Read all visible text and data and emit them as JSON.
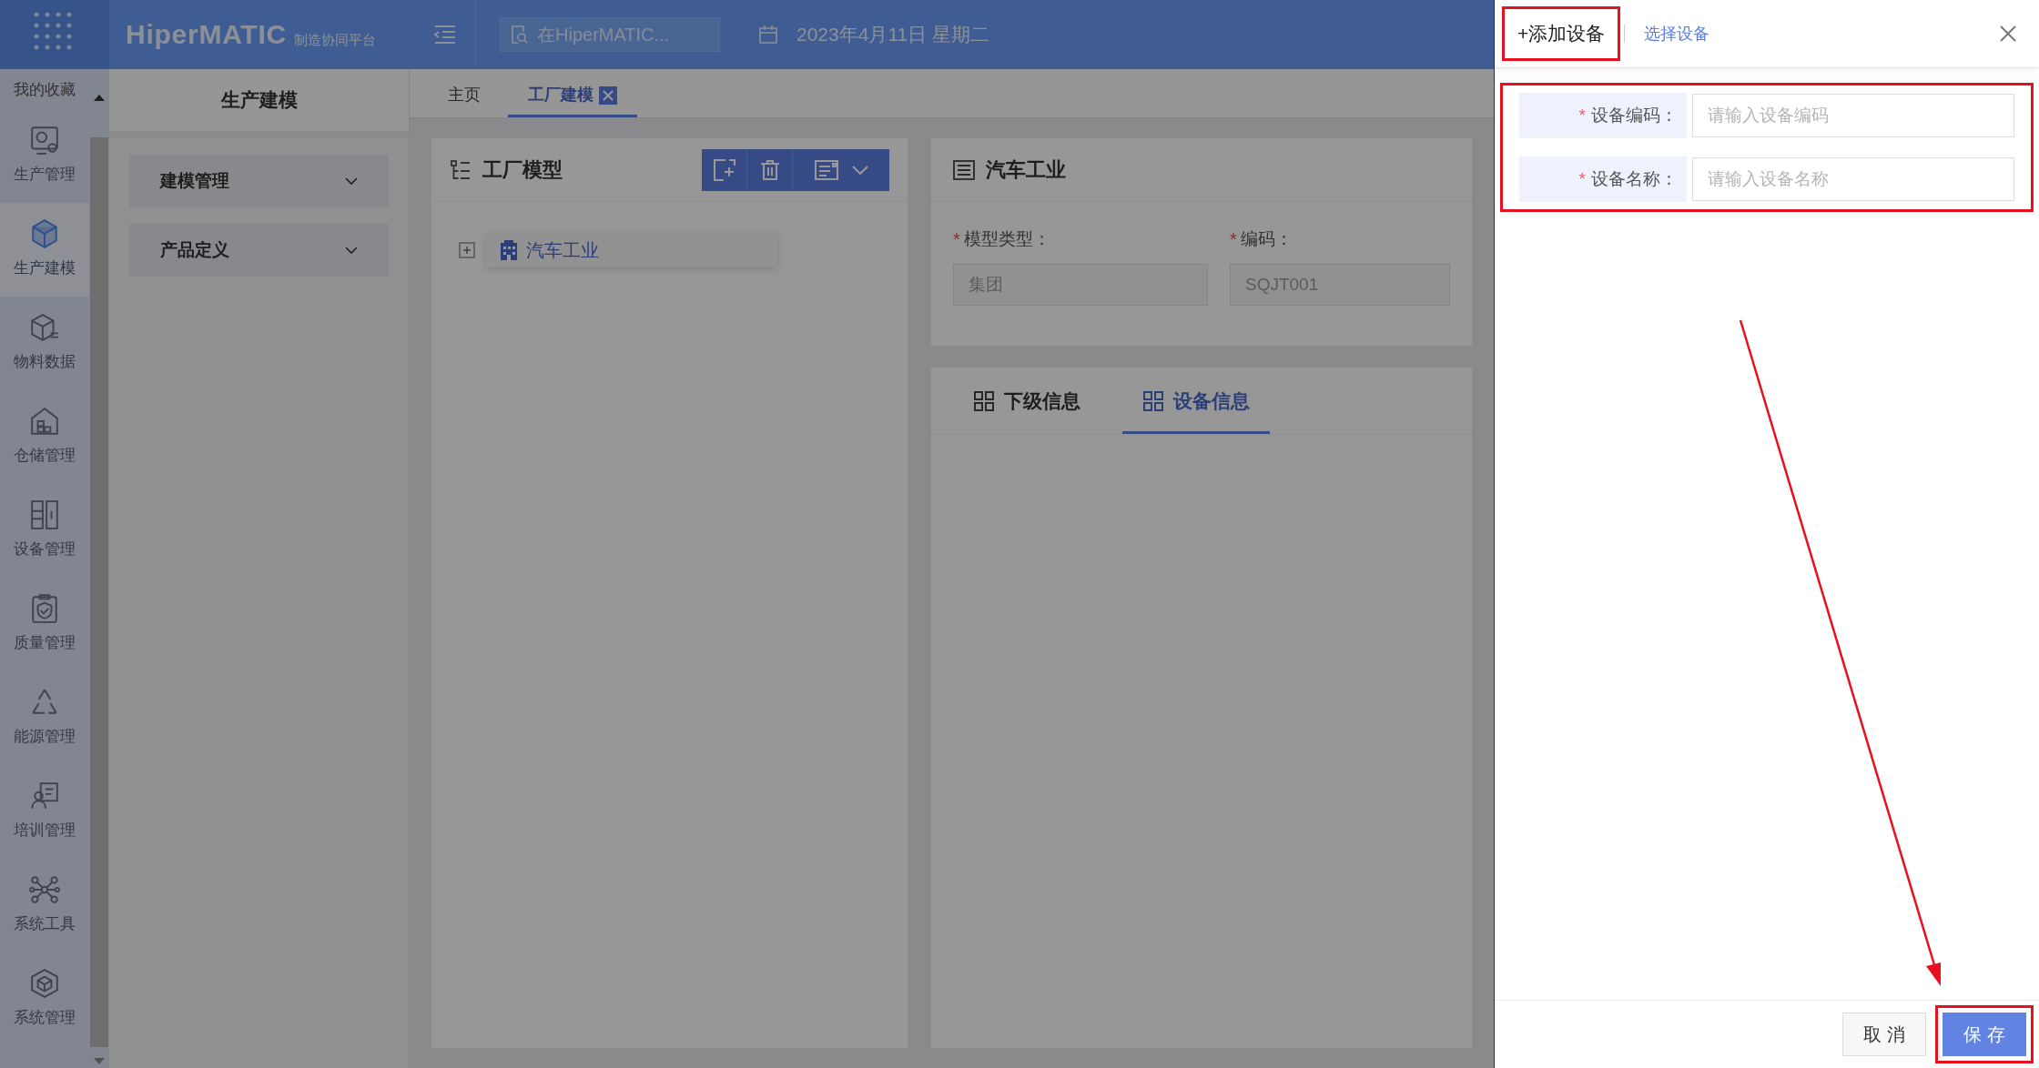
{
  "modal_open": true,
  "top_bar": {
    "logo_text": "HiperMATIC",
    "logo_subtitle": "制造协同平台",
    "search": {
      "placeholder": "在HiperMATIC..."
    },
    "date": "2023年4月11日 星期二"
  },
  "rail": {
    "favorites": "我的收藏",
    "items": [
      {
        "label": "生产管理",
        "selected": false
      },
      {
        "label": "生产建模",
        "selected": true
      },
      {
        "label": "物料数据",
        "selected": false
      },
      {
        "label": "仓储管理",
        "selected": false
      },
      {
        "label": "设备管理",
        "selected": false
      },
      {
        "label": "质量管理",
        "selected": false
      },
      {
        "label": "能源管理",
        "selected": false
      },
      {
        "label": "培训管理",
        "selected": false
      },
      {
        "label": "系统工具",
        "selected": false
      },
      {
        "label": "系统管理",
        "selected": false
      }
    ]
  },
  "submenu": {
    "title": "生产建模",
    "groups": [
      {
        "label": "建模管理",
        "expanded": false
      },
      {
        "label": "产品定义",
        "expanded": false
      }
    ]
  },
  "tabs": [
    {
      "label": "主页",
      "selected": false,
      "closable": false
    },
    {
      "label": "工厂建模",
      "selected": true,
      "closable": true
    }
  ],
  "tree_card": {
    "title": "工厂模型",
    "tree": [
      {
        "label": "汽车工业",
        "expanded": false,
        "selected": true
      }
    ]
  },
  "detail_card": {
    "title": "汽车工业",
    "fields": [
      {
        "label": "模型类型：",
        "required_mark": "*",
        "value": "集团"
      },
      {
        "label": "编码：",
        "required_mark": "*",
        "value": "SQJT001"
      }
    ]
  },
  "info_tabs": [
    {
      "label": "下级信息",
      "selected": false
    },
    {
      "label": "设备信息",
      "selected": true
    }
  ],
  "drawer": {
    "tabs": [
      {
        "label": "+添加设备",
        "selected": true,
        "highlighted": true
      },
      {
        "label": "选择设备",
        "selected": false,
        "highlighted": false
      }
    ],
    "form_highlighted": true,
    "fields": [
      {
        "label": "设备编码：",
        "required_mark": "*",
        "placeholder": "请输入设备编码"
      },
      {
        "label": "设备名称：",
        "required_mark": "*",
        "placeholder": "请输入设备名称"
      }
    ],
    "buttons": [
      {
        "label": "取 消",
        "kind": "secondary",
        "highlighted": false
      },
      {
        "label": "保 存",
        "kind": "primary",
        "highlighted": true
      }
    ],
    "pointer_arrow": true
  }
}
